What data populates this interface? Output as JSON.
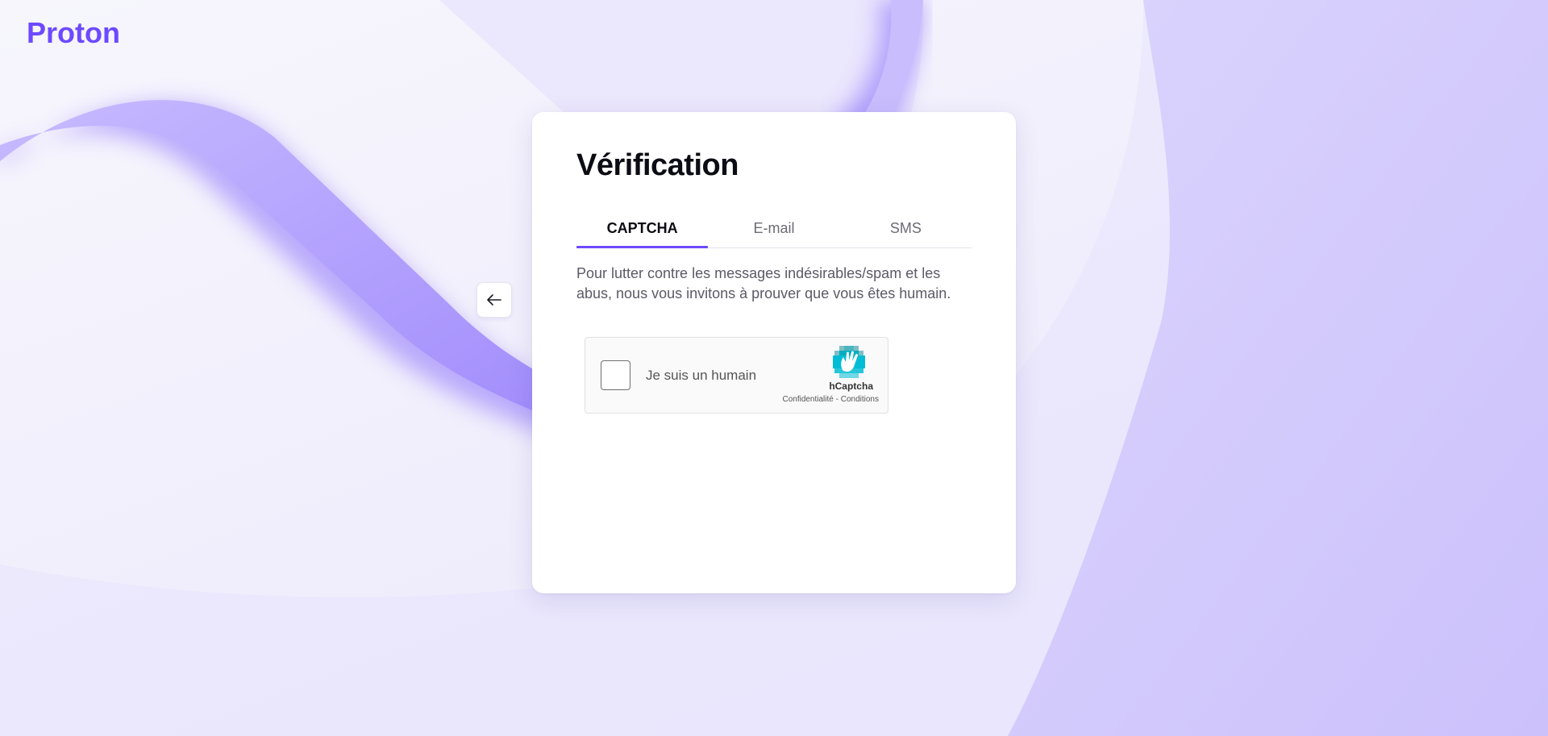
{
  "brand": {
    "name": "Proton",
    "color": "#6d4aff"
  },
  "back_button": {
    "icon": "arrow-left-icon"
  },
  "card": {
    "title": "Vérification",
    "tabs": [
      {
        "label": "CAPTCHA",
        "active": true
      },
      {
        "label": "E-mail",
        "active": false
      },
      {
        "label": "SMS",
        "active": false
      }
    ],
    "description": "Pour lutter contre les messages indésirables/spam et les abus, nous vous invitons à prouver que vous êtes humain."
  },
  "hcaptcha": {
    "checkbox_label": "Je suis un humain",
    "checked": false,
    "brand": "hCaptcha",
    "privacy_link": "Confidentialité",
    "separator": " - ",
    "terms_link": "Conditions",
    "logo_icon": "hcaptcha-hand-icon"
  },
  "colors": {
    "accent": "#6d4aff",
    "background": "#f1effc",
    "card": "#ffffff"
  }
}
